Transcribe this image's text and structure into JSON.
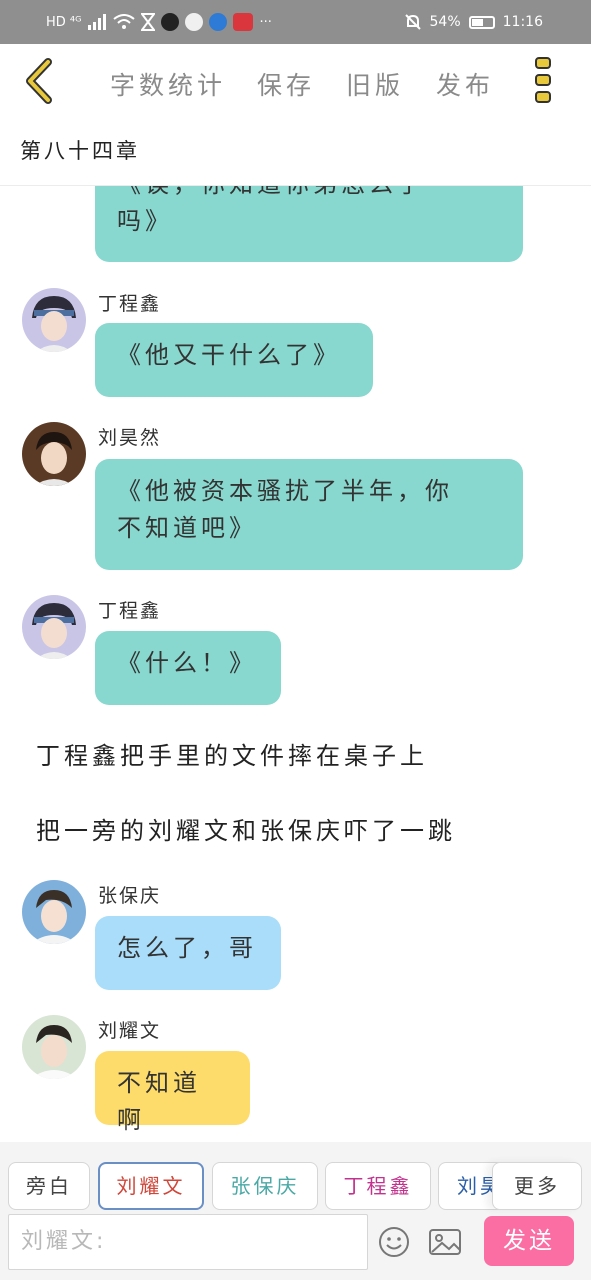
{
  "status_bar": {
    "left_text": "HD ⁴ᴳ",
    "battery": "54%",
    "time": "11:16"
  },
  "toolbar": {
    "back_icon": "chevron-left-icon",
    "items": [
      "字数统计",
      "保存",
      "旧版",
      "发布"
    ],
    "more_icon": "vertical-dots-icon",
    "accent_color": "#e8c93c"
  },
  "chapter_title": "第八十四章",
  "messages": [
    {
      "speaker": "",
      "text": "《诶，你知道你弟怎么了吗》",
      "line1": "《诶，你知道你弟怎么了",
      "line2": "吗》",
      "color": "#88d8cf"
    },
    {
      "speaker": "丁程鑫",
      "text": "《他又干什么了》",
      "color": "#88d8cf"
    },
    {
      "speaker": "刘昊然",
      "text": "《他被资本骚扰了半年，你不知道吧》",
      "line1": "《他被资本骚扰了半年，你",
      "line2": "不知道吧》",
      "color": "#88d8cf"
    },
    {
      "speaker": "丁程鑫",
      "text": "《什么！》",
      "color": "#88d8cf"
    },
    {
      "speaker": "张保庆",
      "text": "怎么了，哥",
      "color": "#a9ddf9"
    },
    {
      "speaker": "刘耀文",
      "text": "不知道啊",
      "color": "#fddc6b"
    }
  ],
  "narrations": [
    "丁程鑫把手里的文件摔在桌子上",
    "把一旁的刘耀文和张保庆吓了一跳"
  ],
  "character_chips": [
    {
      "label": "旁白",
      "color": "#444444"
    },
    {
      "label": "刘耀文",
      "color": "#d0473a",
      "selected": true
    },
    {
      "label": "张保庆",
      "color": "#4aa9a5"
    },
    {
      "label": "丁程鑫",
      "color": "#c2328e"
    },
    {
      "label": "刘昊",
      "color": "#2a5ea8"
    }
  ],
  "more_chip_label": "更多",
  "input": {
    "placeholder": "刘耀文:"
  },
  "send_label": "发送"
}
